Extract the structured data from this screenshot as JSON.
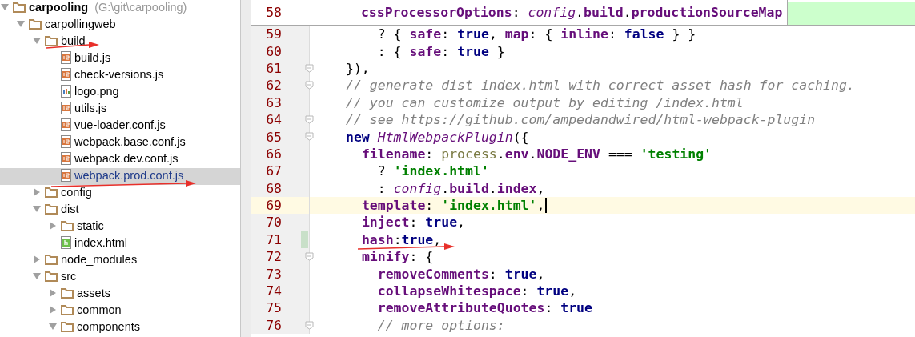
{
  "project_tree": [
    {
      "label": "carpooling",
      "path": "(G:\\git\\carpooling)",
      "kind": "folder",
      "expanded": true,
      "selected": false,
      "children": [
        {
          "label": "carpollingweb",
          "kind": "folder",
          "expanded": true,
          "selected": false,
          "children": [
            {
              "label": "build",
              "kind": "folder",
              "expanded": true,
              "selected": false,
              "children": [
                {
                  "label": "build.js",
                  "kind": "js",
                  "selected": false
                },
                {
                  "label": "check-versions.js",
                  "kind": "js",
                  "selected": false
                },
                {
                  "label": "logo.png",
                  "kind": "image",
                  "selected": false
                },
                {
                  "label": "utils.js",
                  "kind": "js",
                  "selected": false
                },
                {
                  "label": "vue-loader.conf.js",
                  "kind": "js",
                  "selected": false
                },
                {
                  "label": "webpack.base.conf.js",
                  "kind": "js",
                  "selected": false
                },
                {
                  "label": "webpack.dev.conf.js",
                  "kind": "js",
                  "selected": false
                },
                {
                  "label": "webpack.prod.conf.js",
                  "kind": "js",
                  "selected": true
                }
              ]
            },
            {
              "label": "config",
              "kind": "folder",
              "expanded": false,
              "selected": false
            },
            {
              "label": "dist",
              "kind": "folder",
              "expanded": true,
              "selected": false,
              "children": [
                {
                  "label": "static",
                  "kind": "folder",
                  "expanded": false,
                  "selected": false
                },
                {
                  "label": "index.html",
                  "kind": "html",
                  "selected": false
                }
              ]
            },
            {
              "label": "node_modules",
              "kind": "folder",
              "expanded": false,
              "selected": false
            },
            {
              "label": "src",
              "kind": "folder",
              "expanded": true,
              "selected": false,
              "children": [
                {
                  "label": "assets",
                  "kind": "folder",
                  "expanded": false,
                  "selected": false
                },
                {
                  "label": "common",
                  "kind": "folder",
                  "expanded": false,
                  "selected": false
                },
                {
                  "label": "components",
                  "kind": "folder",
                  "expanded": true,
                  "selected": false
                }
              ]
            }
          ]
        }
      ]
    }
  ],
  "editor": {
    "sticky_line": {
      "number": "58",
      "changed": true,
      "tokens": [
        {
          "kind": "prop",
          "text": "  cssProcessorOptions"
        },
        {
          "kind": "plain",
          "text": ": "
        },
        {
          "kind": "global",
          "text": "config"
        },
        {
          "kind": "plain",
          "text": "."
        },
        {
          "kind": "prop",
          "text": "build"
        },
        {
          "kind": "plain",
          "text": "."
        },
        {
          "kind": "prop",
          "text": "productionSourceMap"
        }
      ]
    },
    "lines": [
      {
        "number": "59",
        "current": false,
        "changed": false,
        "fold": false,
        "tokens": [
          {
            "kind": "plain",
            "text": "    ? { "
          },
          {
            "kind": "prop",
            "text": "safe"
          },
          {
            "kind": "plain",
            "text": ": "
          },
          {
            "kind": "keyword",
            "text": "true"
          },
          {
            "kind": "plain",
            "text": ", "
          },
          {
            "kind": "prop",
            "text": "map"
          },
          {
            "kind": "plain",
            "text": ": { "
          },
          {
            "kind": "prop",
            "text": "inline"
          },
          {
            "kind": "plain",
            "text": ": "
          },
          {
            "kind": "keyword",
            "text": "false"
          },
          {
            "kind": "plain",
            "text": " } }"
          }
        ]
      },
      {
        "number": "60",
        "current": false,
        "changed": false,
        "fold": false,
        "tokens": [
          {
            "kind": "plain",
            "text": "    : { "
          },
          {
            "kind": "prop",
            "text": "safe"
          },
          {
            "kind": "plain",
            "text": ": "
          },
          {
            "kind": "keyword",
            "text": "true"
          },
          {
            "kind": "plain",
            "text": " }"
          }
        ]
      },
      {
        "number": "61",
        "current": false,
        "changed": false,
        "fold": true,
        "tokens": [
          {
            "kind": "plain",
            "text": "}),"
          }
        ]
      },
      {
        "number": "62",
        "current": false,
        "changed": false,
        "fold": true,
        "tokens": [
          {
            "kind": "comment",
            "text": "// generate dist index.html with correct asset hash for caching."
          }
        ]
      },
      {
        "number": "63",
        "current": false,
        "changed": false,
        "fold": false,
        "tokens": [
          {
            "kind": "comment",
            "text": "// you can customize output by editing /index.html"
          }
        ]
      },
      {
        "number": "64",
        "current": false,
        "changed": false,
        "fold": true,
        "tokens": [
          {
            "kind": "comment",
            "text": "// see https://github.com/ampedandwired/html-webpack-plugin"
          }
        ]
      },
      {
        "number": "65",
        "current": false,
        "changed": false,
        "fold": true,
        "tokens": [
          {
            "kind": "keyword",
            "text": "new "
          },
          {
            "kind": "class",
            "text": "HtmlWebpackPlugin"
          },
          {
            "kind": "plain",
            "text": "({"
          }
        ]
      },
      {
        "number": "66",
        "current": false,
        "changed": false,
        "fold": false,
        "tokens": [
          {
            "kind": "prop",
            "text": "  filename"
          },
          {
            "kind": "plain",
            "text": ": "
          },
          {
            "kind": "dim",
            "text": "process"
          },
          {
            "kind": "plain",
            "text": "."
          },
          {
            "kind": "prop",
            "text": "env"
          },
          {
            "kind": "plain",
            "text": "."
          },
          {
            "kind": "prop",
            "text": "NODE_ENV"
          },
          {
            "kind": "plain",
            "text": " === "
          },
          {
            "kind": "string",
            "text": "'testing'"
          }
        ]
      },
      {
        "number": "67",
        "current": false,
        "changed": false,
        "fold": false,
        "tokens": [
          {
            "kind": "plain",
            "text": "    ? "
          },
          {
            "kind": "string",
            "text": "'index.html'"
          }
        ]
      },
      {
        "number": "68",
        "current": false,
        "changed": false,
        "fold": false,
        "tokens": [
          {
            "kind": "plain",
            "text": "    : "
          },
          {
            "kind": "global",
            "text": "config"
          },
          {
            "kind": "plain",
            "text": "."
          },
          {
            "kind": "prop",
            "text": "build"
          },
          {
            "kind": "plain",
            "text": "."
          },
          {
            "kind": "prop",
            "text": "index"
          },
          {
            "kind": "plain",
            "text": ","
          }
        ]
      },
      {
        "number": "69",
        "current": true,
        "changed": false,
        "fold": false,
        "tokens": [
          {
            "kind": "prop",
            "text": "  template"
          },
          {
            "kind": "plain",
            "text": ": "
          },
          {
            "kind": "string",
            "text": "'index.html'"
          },
          {
            "kind": "plain",
            "text": ","
          }
        ]
      },
      {
        "number": "70",
        "current": false,
        "changed": false,
        "fold": false,
        "tokens": [
          {
            "kind": "prop",
            "text": "  inject"
          },
          {
            "kind": "plain",
            "text": ": "
          },
          {
            "kind": "keyword",
            "text": "true"
          },
          {
            "kind": "plain",
            "text": ","
          }
        ]
      },
      {
        "number": "71",
        "current": false,
        "changed": true,
        "fold": false,
        "tokens": [
          {
            "kind": "prop",
            "text": "  hash"
          },
          {
            "kind": "plain",
            "text": ":"
          },
          {
            "kind": "keyword",
            "text": "true"
          },
          {
            "kind": "plain",
            "text": ","
          }
        ]
      },
      {
        "number": "72",
        "current": false,
        "changed": false,
        "fold": true,
        "tokens": [
          {
            "kind": "prop",
            "text": "  minify"
          },
          {
            "kind": "plain",
            "text": ": {"
          }
        ]
      },
      {
        "number": "73",
        "current": false,
        "changed": false,
        "fold": false,
        "tokens": [
          {
            "kind": "prop",
            "text": "    removeComments"
          },
          {
            "kind": "plain",
            "text": ": "
          },
          {
            "kind": "keyword",
            "text": "true"
          },
          {
            "kind": "plain",
            "text": ","
          }
        ]
      },
      {
        "number": "74",
        "current": false,
        "changed": false,
        "fold": false,
        "tokens": [
          {
            "kind": "prop",
            "text": "    collapseWhitespace"
          },
          {
            "kind": "plain",
            "text": ": "
          },
          {
            "kind": "keyword",
            "text": "true"
          },
          {
            "kind": "plain",
            "text": ","
          }
        ]
      },
      {
        "number": "75",
        "current": false,
        "changed": false,
        "fold": false,
        "tokens": [
          {
            "kind": "prop",
            "text": "    removeAttributeQuotes"
          },
          {
            "kind": "plain",
            "text": ": "
          },
          {
            "kind": "keyword",
            "text": "true"
          }
        ]
      },
      {
        "number": "76",
        "current": false,
        "changed": false,
        "fold": true,
        "tokens": [
          {
            "kind": "comment",
            "text": "    // more options:"
          }
        ]
      }
    ]
  }
}
